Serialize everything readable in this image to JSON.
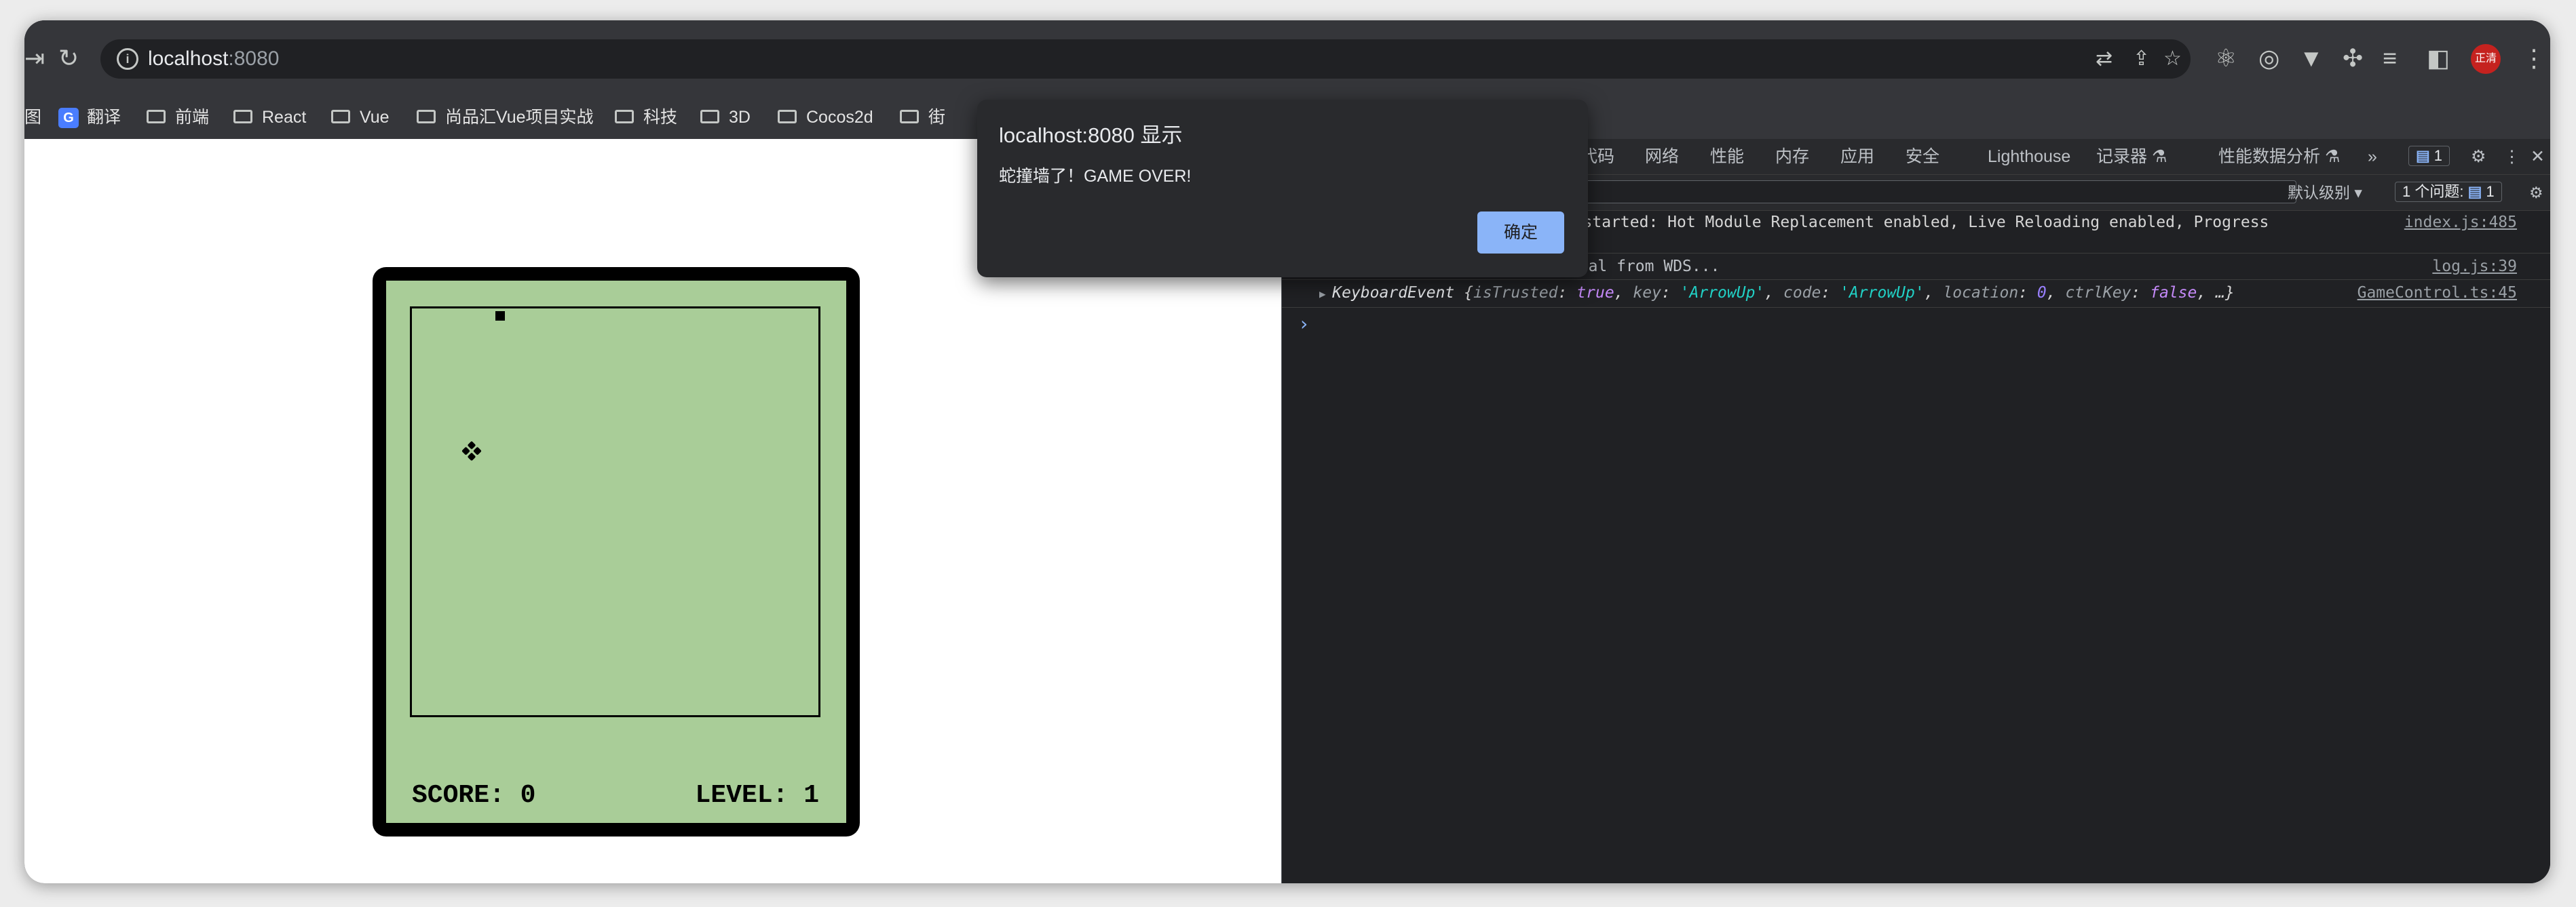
{
  "toolbar": {
    "url_host": "localhost",
    "url_port": ":8080",
    "avatar_label": "正清"
  },
  "bookmarks": [
    {
      "label": "图",
      "icon": "none"
    },
    {
      "label": "翻译",
      "icon": "google-translate-icon"
    },
    {
      "label": "前端",
      "icon": "folder-icon"
    },
    {
      "label": "React",
      "icon": "folder-icon"
    },
    {
      "label": "Vue",
      "icon": "folder-icon"
    },
    {
      "label": "尚品汇Vue项目实战",
      "icon": "folder-icon"
    },
    {
      "label": "科技",
      "icon": "folder-icon"
    },
    {
      "label": "3D",
      "icon": "folder-icon"
    },
    {
      "label": "Cocos2d",
      "icon": "folder-icon"
    },
    {
      "label": "街",
      "icon": "folder-icon"
    }
  ],
  "game": {
    "score_label": "SCORE:",
    "score_value": "0",
    "level_label": "LEVEL:",
    "level_value": "1",
    "stage_color": "#a9cd98"
  },
  "dialog": {
    "title": "localhost:8080 显示",
    "message": "蛇撞墙了！GAME OVER!",
    "ok_label": "确定"
  },
  "devtools": {
    "tabs": [
      "代码",
      "网络",
      "性能",
      "内存",
      "应用",
      "安全",
      "Lighthouse",
      "记录器 ⚗",
      "性能数据分析 ⚗",
      "»"
    ],
    "message_count": "1",
    "default_levels": "默认级别 ▾",
    "issues_label": "1 个问题:",
    "issues_count": "1",
    "console": {
      "line1_text": "er started: Hot Module Replacement enabled, Live Reloading enabled, Progress",
      "line1_cont": ".",
      "line1_src": "index.js:485",
      "line2_text": "[HMR] Waiting for update signal from WDS...",
      "line2_src": "log.js:39",
      "line3_src": "GameControl.ts:45",
      "line3": {
        "type": "KeyboardEvent",
        "open": " {",
        "k1": "isTrusted",
        "v1": "true",
        "k2": "key",
        "v2": "'ArrowUp'",
        "k3": "code",
        "v3": "'ArrowUp'",
        "k4": "location",
        "v4": "0",
        "k5": "ctrlKey",
        "v5": "false",
        "tail": ", …}"
      },
      "prompt": "›"
    }
  },
  "colors": {
    "game_border": "#000000",
    "game_bg": "#a9cd98",
    "dialog_button": "#8ab4f8",
    "devtools_bg": "#202124"
  }
}
